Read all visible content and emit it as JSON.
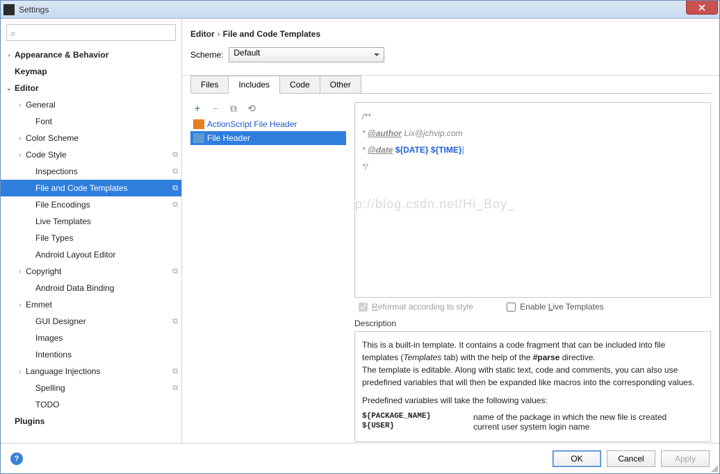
{
  "window": {
    "title": "Settings"
  },
  "search": {
    "placeholder": ""
  },
  "tree": [
    {
      "label": "Appearance & Behavior",
      "level": 0,
      "bold": true,
      "arrow": ">"
    },
    {
      "label": "Keymap",
      "level": 0,
      "bold": true
    },
    {
      "label": "Editor",
      "level": 0,
      "bold": true,
      "arrow": "v"
    },
    {
      "label": "General",
      "level": 1,
      "arrow": ">"
    },
    {
      "label": "Font",
      "level": 2
    },
    {
      "label": "Color Scheme",
      "level": 1,
      "arrow": ">"
    },
    {
      "label": "Code Style",
      "level": 1,
      "arrow": ">",
      "copy": true
    },
    {
      "label": "Inspections",
      "level": 2,
      "copy": true
    },
    {
      "label": "File and Code Templates",
      "level": 2,
      "copy": true,
      "selected": true
    },
    {
      "label": "File Encodings",
      "level": 2,
      "copy": true
    },
    {
      "label": "Live Templates",
      "level": 2
    },
    {
      "label": "File Types",
      "level": 2
    },
    {
      "label": "Android Layout Editor",
      "level": 2
    },
    {
      "label": "Copyright",
      "level": 1,
      "arrow": ">",
      "copy": true
    },
    {
      "label": "Android Data Binding",
      "level": 2
    },
    {
      "label": "Emmet",
      "level": 1,
      "arrow": ">"
    },
    {
      "label": "GUI Designer",
      "level": 2,
      "copy": true
    },
    {
      "label": "Images",
      "level": 2
    },
    {
      "label": "Intentions",
      "level": 2
    },
    {
      "label": "Language Injections",
      "level": 1,
      "arrow": ">",
      "copy": true
    },
    {
      "label": "Spelling",
      "level": 2,
      "copy": true
    },
    {
      "label": "TODO",
      "level": 2
    },
    {
      "label": "Plugins",
      "level": 0,
      "bold": true
    }
  ],
  "breadcrumb": {
    "part1": "Editor",
    "sep": "›",
    "part2": "File and Code Templates"
  },
  "scheme": {
    "label": "Scheme:",
    "value": "Default"
  },
  "tabs": [
    "Files",
    "Includes",
    "Code",
    "Other"
  ],
  "active_tab": 1,
  "file_list": [
    {
      "name": "ActionScript File Header",
      "icon": "as",
      "link": true
    },
    {
      "name": "File Header",
      "icon": "h",
      "selected": true
    }
  ],
  "template": {
    "l1": "/**",
    "l2_prefix": " * ",
    "l2_tag": "@author",
    "l2_rest": " Lix@jchvip.com",
    "l3_prefix": " * ",
    "l3_tag": "@date",
    "l3_v1": " ${DATE}",
    "l3_v2": " ${TIME}",
    "l4": " */"
  },
  "watermark": "http://blog.csdn.net/Hi_Boy_",
  "checks": {
    "reformat": "Reformat according to style",
    "live": "Enable Live Templates"
  },
  "description": {
    "label": "Description",
    "p1a": "This is a built-in template. It contains a code fragment that can be included into file templates (",
    "p1b": "Templates",
    "p1c": " tab) with the help of the ",
    "p1d": "#parse",
    "p1e": " directive.",
    "p2": "The template is editable. Along with static text, code and comments, you can also use predefined variables that will then be expanded like macros into the corresponding values.",
    "p3": "Predefined variables will take the following values:",
    "vars": [
      {
        "name": "${PACKAGE_NAME}",
        "desc": "name of the package in which the new file is created"
      },
      {
        "name": "${USER}",
        "desc": "current user system login name"
      }
    ]
  },
  "buttons": {
    "ok": "OK",
    "cancel": "Cancel",
    "apply": "Apply"
  }
}
